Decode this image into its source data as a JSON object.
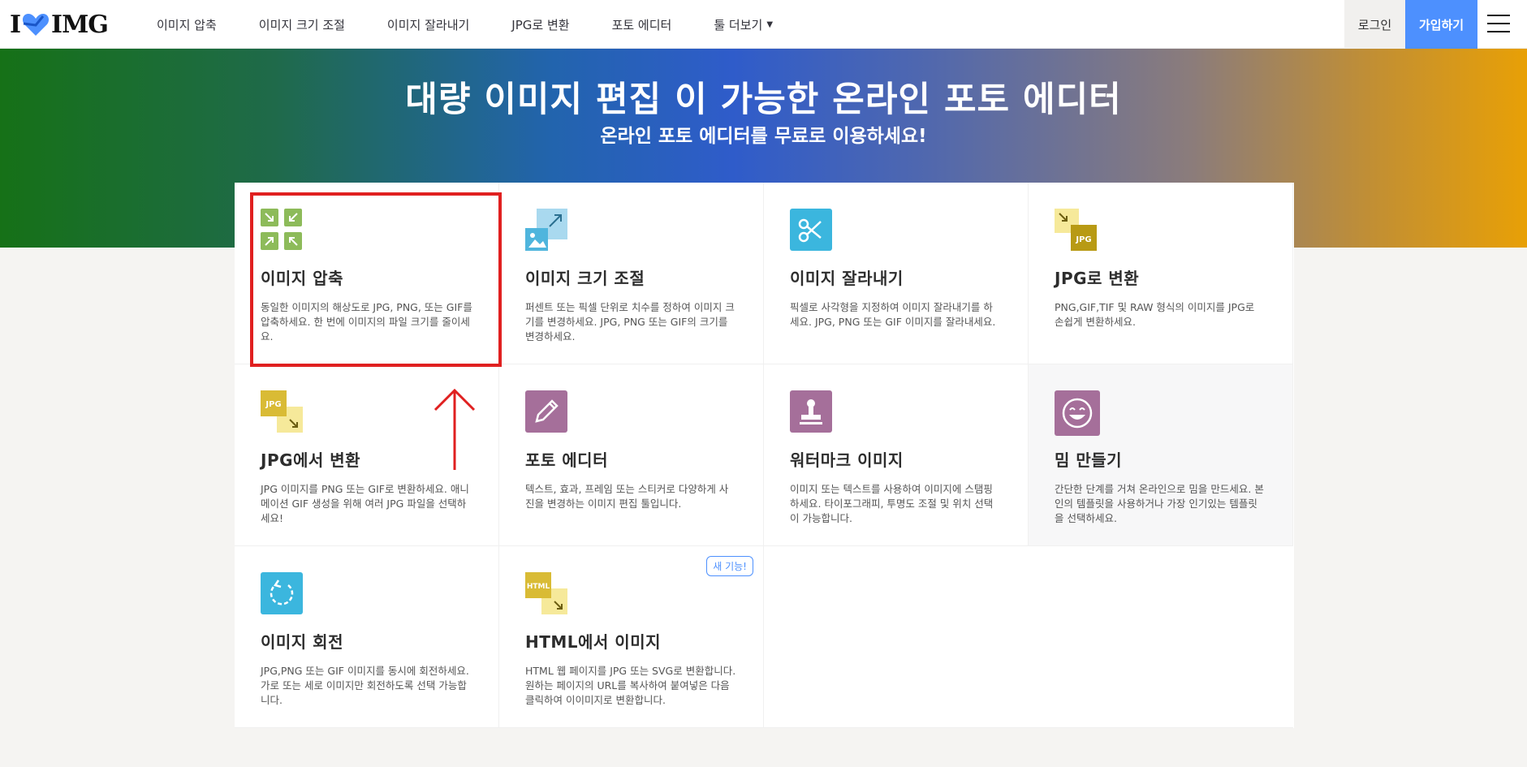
{
  "header": {
    "logo_text_left": "I",
    "logo_text_right": "IMG",
    "nav": [
      {
        "label": "이미지 압축"
      },
      {
        "label": "이미지 크기 조절"
      },
      {
        "label": "이미지 잘라내기"
      },
      {
        "label": "JPG로 변환"
      },
      {
        "label": "포토 에디터"
      },
      {
        "label": "툴 더보기"
      }
    ],
    "login_label": "로그인",
    "signup_label": "가입하기"
  },
  "hero": {
    "title": "대량 이미지 편집 이 가능한 온라인 포토 에디터",
    "subtitle": "온라인 포토 에디터를 무료로 이용하세요!"
  },
  "tools": [
    {
      "title": "이미지 압축",
      "desc": "동일한 이미지의 해상도로 JPG, PNG, 또는 GIF를 압축하세요. 한 번에 이미지의 파일 크기를 줄이세요.",
      "icon": "compress-icon",
      "color": "#8dbb5a"
    },
    {
      "title": "이미지 크기 조절",
      "desc": "퍼센트 또는 픽셀 단위로 치수를 정하여 이미지 크기를 변경하세요. JPG, PNG 또는 GIF의 크기를 변경하세요.",
      "icon": "resize-icon",
      "color": "#4fb5dd"
    },
    {
      "title": "이미지 잘라내기",
      "desc": "픽셀로 사각형을 지정하여 이미지 잘라내기를 하세요. JPG, PNG 또는 GIF 이미지를 잘라내세요.",
      "icon": "crop-icon",
      "color": "#3bb6de"
    },
    {
      "title": "JPG로 변환",
      "desc": "PNG,GIF,TIF 및 RAW 형식의 이미지를 JPG로 손쉽게 변환하세요.",
      "icon": "to-jpg-icon",
      "color": "#c6a620"
    },
    {
      "title": "JPG에서 변환",
      "desc": "JPG 이미지를 PNG 또는 GIF로 변환하세요. 애니메이션 GIF 생성을 위해 여러 JPG 파일을 선택하세요!",
      "icon": "from-jpg-icon",
      "color": "#d9bb35"
    },
    {
      "title": "포토 에디터",
      "desc": "텍스트, 효과, 프레임 또는 스티커로 다양하게 사진을 변경하는 이미지 편집 툴입니다.",
      "icon": "pencil-icon",
      "color": "#a56f9a"
    },
    {
      "title": "워터마크 이미지",
      "desc": "이미지 또는 텍스트를 사용하여 이미지에 스탬핑하세요. 타이포그래피, 투명도 조절 및 위치 선택이 가능합니다.",
      "icon": "stamp-icon",
      "color": "#a56f9a"
    },
    {
      "title": "밈 만들기",
      "desc": "간단한 단계를 거쳐 온라인으로 밈을 만드세요. 본인의 템플릿을 사용하거나 가장 인기있는 템플릿을 선택하세요.",
      "icon": "smiley-icon",
      "color": "#a56f9a"
    },
    {
      "title": "이미지 회전",
      "desc": "JPG,PNG 또는 GIF 이미지를 동시에 회전하세요. 가로 또는 세로 이미지만 회전하도록 선택 가능합니다.",
      "icon": "rotate-icon",
      "color": "#3bb6de"
    },
    {
      "title": "HTML에서 이미지",
      "desc": "HTML 웹 페이지를 JPG 또는 SVG로 변환합니다. 원하는 페이지의 URL를 복사하여 붙여넣은 다음 클릭하여 이이미지로 변환합니다.",
      "icon": "html-icon",
      "color": "#d9bb35",
      "badge": "새 기능!"
    }
  ],
  "icon_labels": {
    "jpg": "JPG",
    "html": "HTML"
  }
}
